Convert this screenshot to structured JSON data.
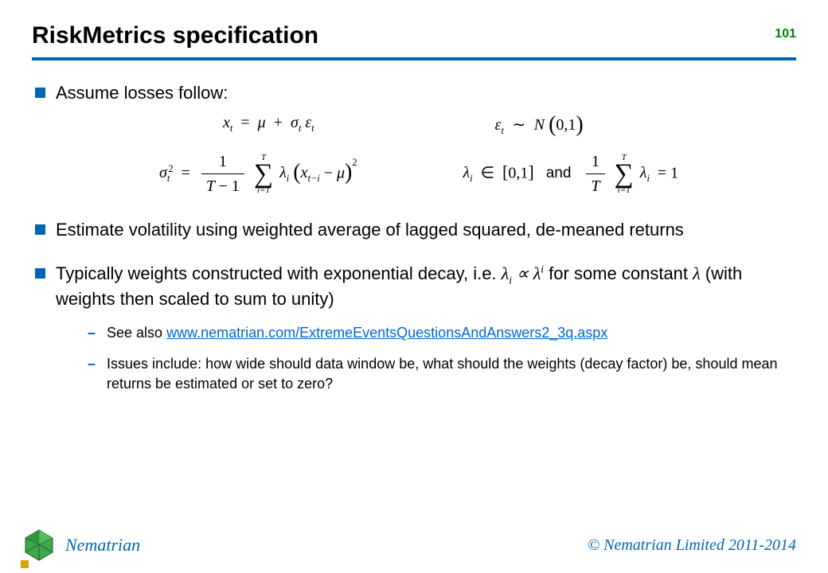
{
  "header": {
    "title": "RiskMetrics specification",
    "slide_number": "101"
  },
  "bullets": {
    "b1": "Assume losses follow:",
    "b2": "Estimate volatility using weighted average of lagged squared, de-meaned returns",
    "b3_pre": "Typically weights constructed with exponential decay, i.e. ",
    "b3_mid": " for some constant ",
    "b3_post": " (with weights then scaled to sum to unity)",
    "sub1_pre": "See also ",
    "sub1_link": "www.nematrian.com/ExtremeEventsQuestionsAndAnswers2_3q.aspx",
    "sub2": "Issues include: how wide should data window be, what should the weights (decay factor) be, should mean returns be estimated or set to zero?"
  },
  "equations": {
    "eq1_left": "x_t = μ + σ_t ε_t",
    "eq1_right": "ε_t ~ N(0,1)",
    "eq2_left": "σ_t^2 = (1/(T-1)) Σ_{i=1}^{T} λ_i (x_{t-i} - μ)^2",
    "eq2_right": "λ_i ∈ [0,1]  and  (1/T) Σ_{i=1}^{T} λ_i = 1",
    "inline1": "λ_i ∝ λ^i",
    "inline2": "λ",
    "and": "and"
  },
  "footer": {
    "brand": "Nematrian",
    "copyright": "© Nematrian Limited 2011-2014"
  },
  "colors": {
    "accent": "#0066b3",
    "green": "#008000",
    "link": "#0066cc",
    "gold": "#d7a500"
  }
}
